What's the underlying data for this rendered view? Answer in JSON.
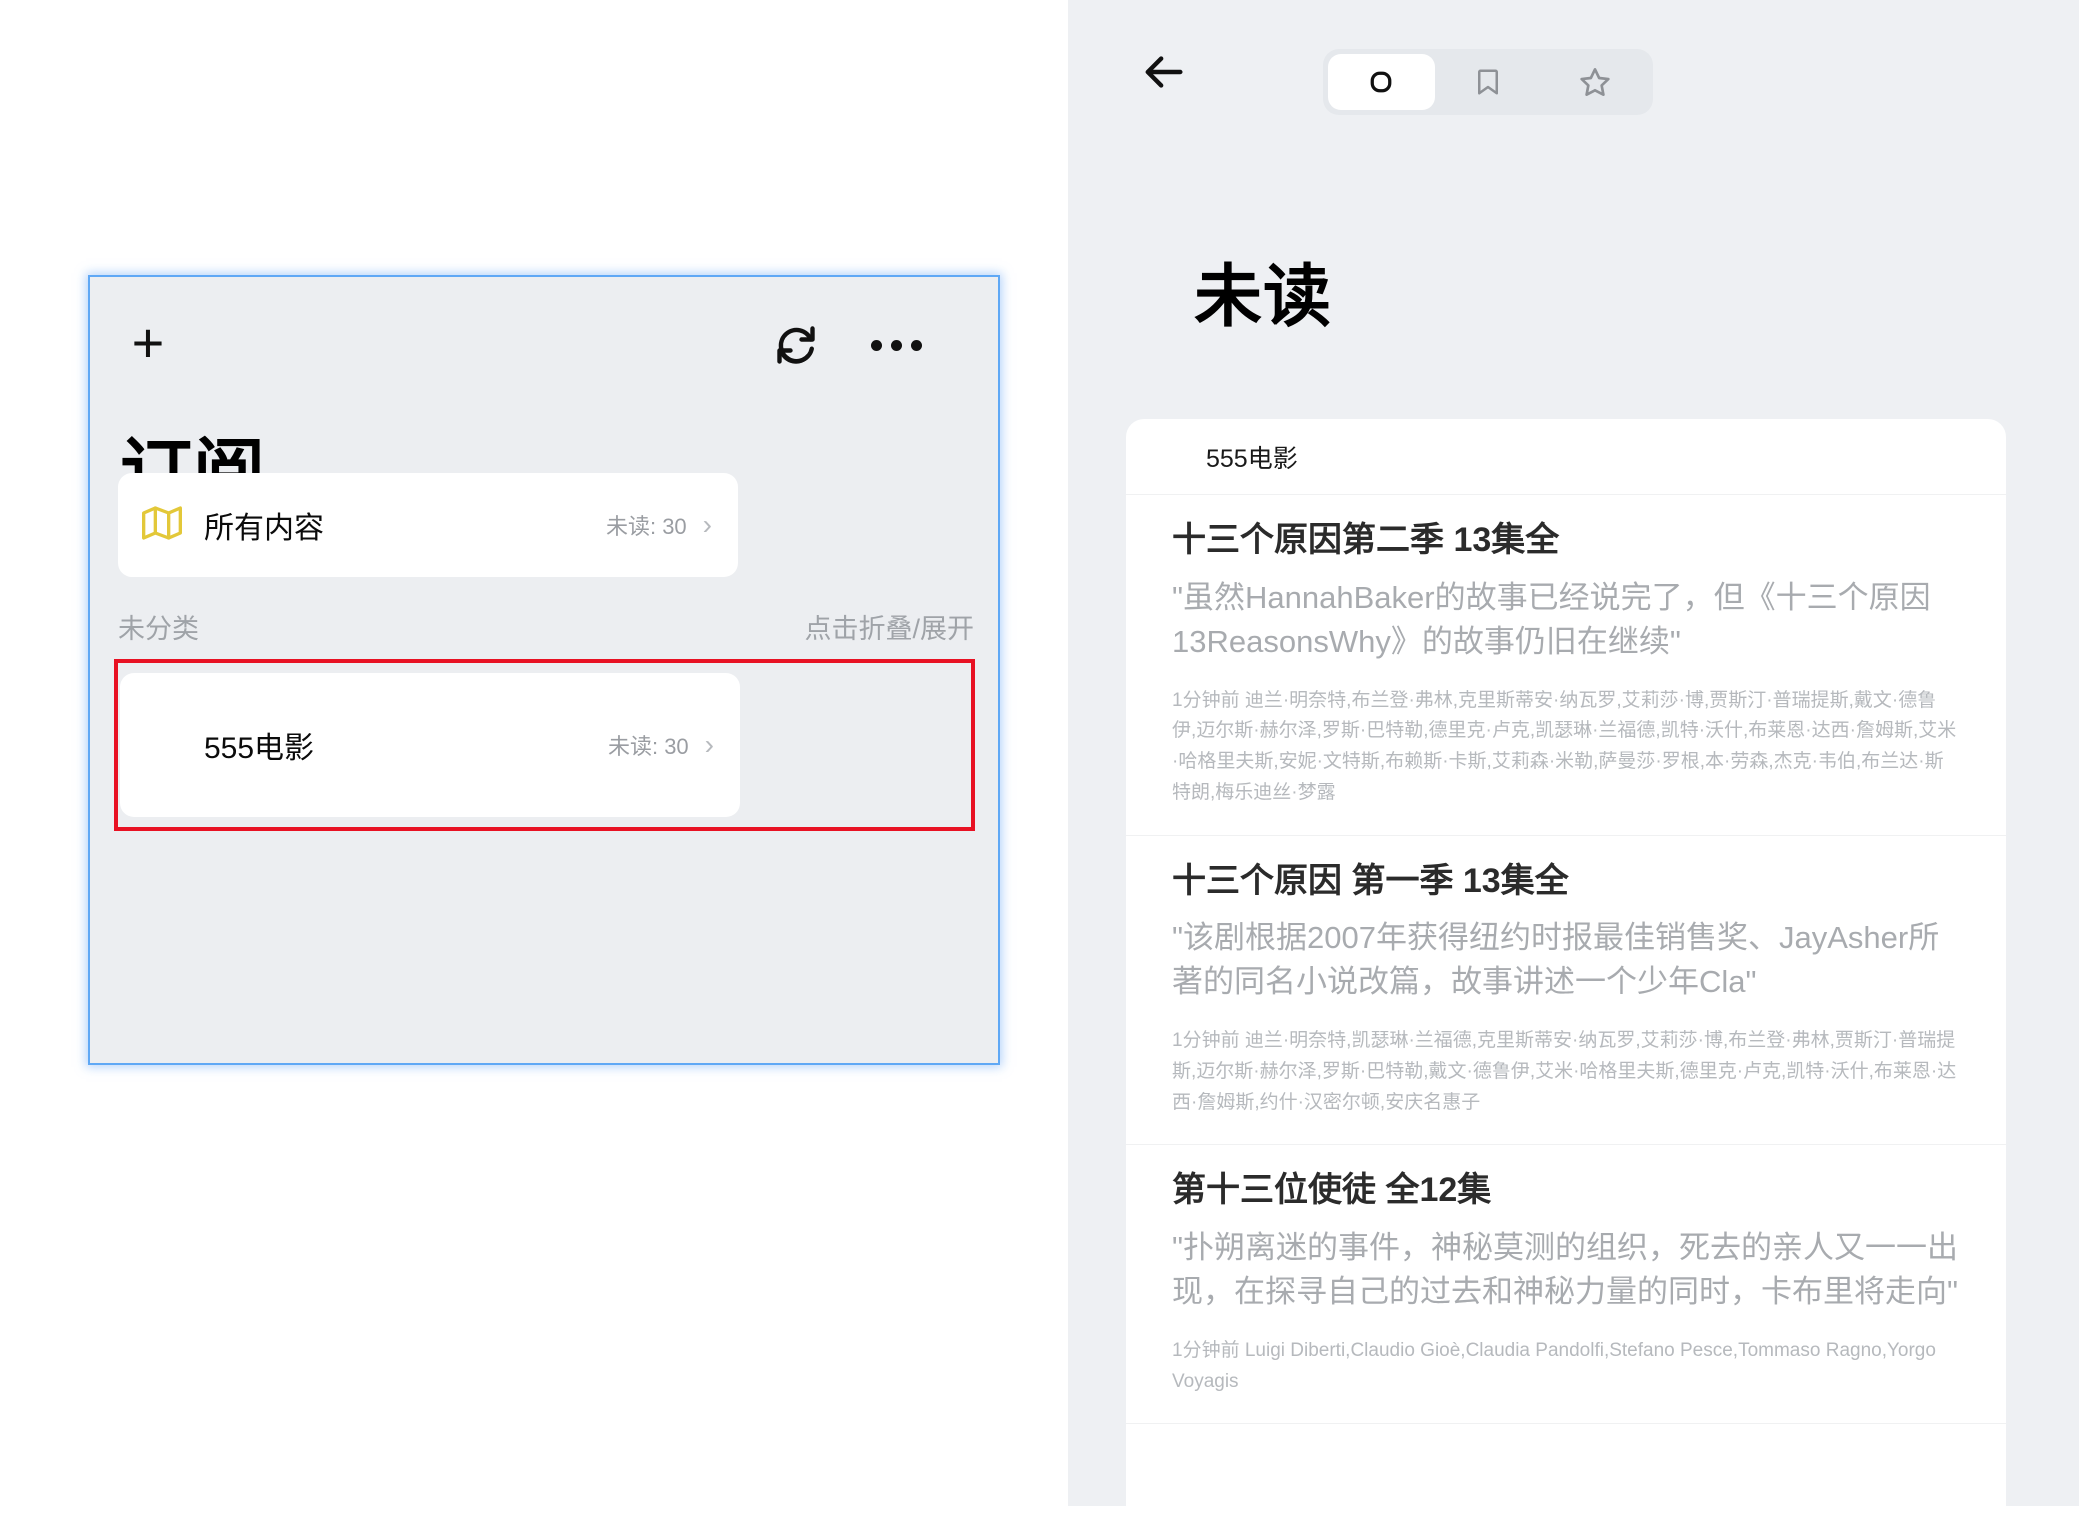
{
  "sidebar": {
    "toolbar": {
      "add_label": "+",
      "refresh_icon": "refresh-icon",
      "more_icon": "more-horizontal-icon"
    },
    "title": "订阅",
    "all_content": {
      "icon": "map-icon",
      "label": "所有内容",
      "unread": "未读: 30",
      "chevron": "›"
    },
    "section": {
      "label": "未分类",
      "hint": "点击折叠/展开"
    },
    "feeds": [
      {
        "label": "555电影",
        "unread": "未读: 30",
        "chevron": "›",
        "highlighted": true
      }
    ]
  },
  "reader": {
    "toolbar": {
      "back_icon": "arrow-left-icon",
      "segments": [
        {
          "name": "unread-circle-icon",
          "selected": true
        },
        {
          "name": "bookmark-icon",
          "selected": false
        },
        {
          "name": "star-icon",
          "selected": false
        }
      ],
      "mark_read_icon": "flag-icon"
    },
    "heading": "未读",
    "feed_name": "555电影",
    "articles": [
      {
        "title": "十三个原因第二季 13集全",
        "description": "\"虽然HannahBaker的故事已经说完了，但《十三个原因13ReasonsWhy》的故事仍旧在继续\"",
        "meta": "1分钟前  迪兰·明奈特,布兰登·弗林,克里斯蒂安·纳瓦罗,艾莉莎·博,贾斯汀·普瑞提斯,戴文·德鲁伊,迈尔斯·赫尔泽,罗斯·巴特勒,德里克·卢克,凯瑟琳·兰福德,凯特·沃什,布莱恩·达西·詹姆斯,艾米·哈格里夫斯,安妮·文特斯,布赖斯·卡斯,艾莉森·米勒,萨曼莎·罗根,本·劳森,杰克·韦伯,布兰达·斯特朗,梅乐迪丝·梦露"
      },
      {
        "title": "十三个原因 第一季 13集全",
        "description": "\"该剧根据2007年获得纽约时报最佳销售奖、JayAsher所著的同名小说改篇，故事讲述一个少年Cla\"",
        "meta": "1分钟前  迪兰·明奈特,凯瑟琳·兰福德,克里斯蒂安·纳瓦罗,艾莉莎·博,布兰登·弗林,贾斯汀·普瑞提斯,迈尔斯·赫尔泽,罗斯·巴特勒,戴文·德鲁伊,艾米·哈格里夫斯,德里克·卢克,凯特·沃什,布莱恩·达西·詹姆斯,约什·汉密尔顿,安庆名惠子"
      },
      {
        "title": "第十三位使徒 全12集",
        "description": "\"扑朔离迷的事件，神秘莫测的组织，死去的亲人又一一出现，在探寻自己的过去和神秘力量的同时，卡布里将走向\"",
        "meta": "1分钟前  Luigi Diberti,Claudio Gioè,Claudia Pandolfi,Stefano Pesce,Tommaso Ragno,Yorgo Voyagis"
      }
    ]
  },
  "colors": {
    "accent_blue": "#5fa8f5",
    "highlight_red": "#e81123",
    "map_icon_gold": "#e3c839",
    "panel_bg": "#eceef1",
    "right_bg": "#eef0f3"
  }
}
